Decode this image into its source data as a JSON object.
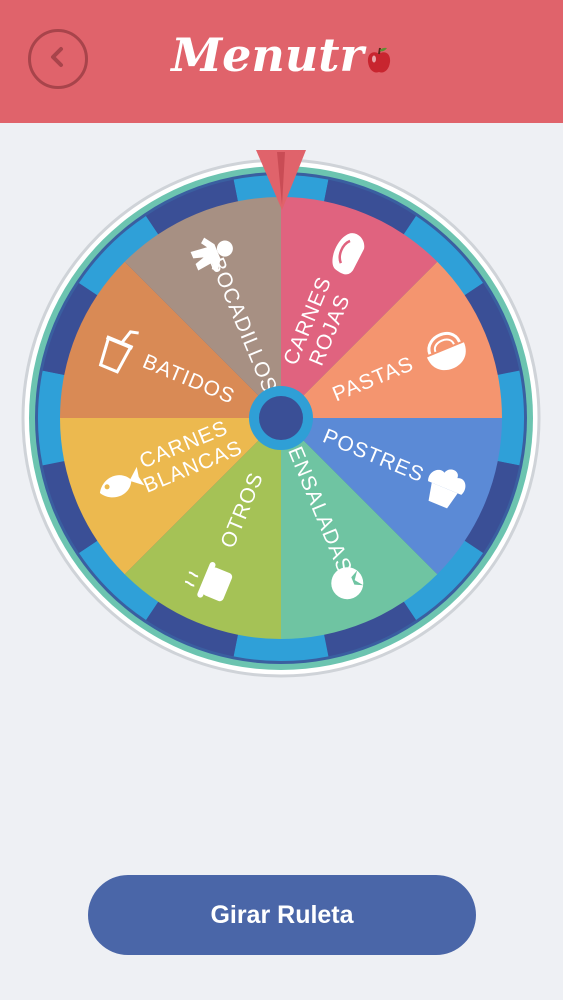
{
  "header": {
    "app_name_prefix": "Menutr",
    "back_icon": "chevron-left-icon",
    "brand_color": "#e0636b"
  },
  "wheel": {
    "pointer_icon": "triangle-pointer-icon",
    "segments": [
      {
        "id": "carnes-rojas",
        "lines": [
          "CARNES",
          "ROJAS"
        ],
        "color": "#e0637f",
        "icon": "meat-icon"
      },
      {
        "id": "pastas",
        "lines": [
          "PASTAS"
        ],
        "color": "#f4956f",
        "icon": "pasta-bowl-icon"
      },
      {
        "id": "postres",
        "lines": [
          "POSTRES"
        ],
        "color": "#5b8ad6",
        "icon": "cupcake-icon"
      },
      {
        "id": "ensaladas",
        "lines": [
          "ENSALADAS"
        ],
        "color": "#6fc4a2",
        "icon": "tomato-icon"
      },
      {
        "id": "otros",
        "lines": [
          "OTROS"
        ],
        "color": "#a5c256",
        "icon": "pot-icon"
      },
      {
        "id": "carnes-blancas",
        "lines": [
          "CARNES",
          "BLANCAS"
        ],
        "color": "#ecb94f",
        "icon": "fish-icon"
      },
      {
        "id": "batidos",
        "lines": [
          "BATIDOS"
        ],
        "color": "#d98a55",
        "icon": "drink-cup-icon"
      },
      {
        "id": "bocadillos",
        "lines": [
          "BOCADILLOS"
        ],
        "color": "#a79083",
        "icon": "gingerbread-icon"
      }
    ]
  },
  "spin_button": {
    "label": "Girar Ruleta",
    "color": "#4a66a8"
  }
}
